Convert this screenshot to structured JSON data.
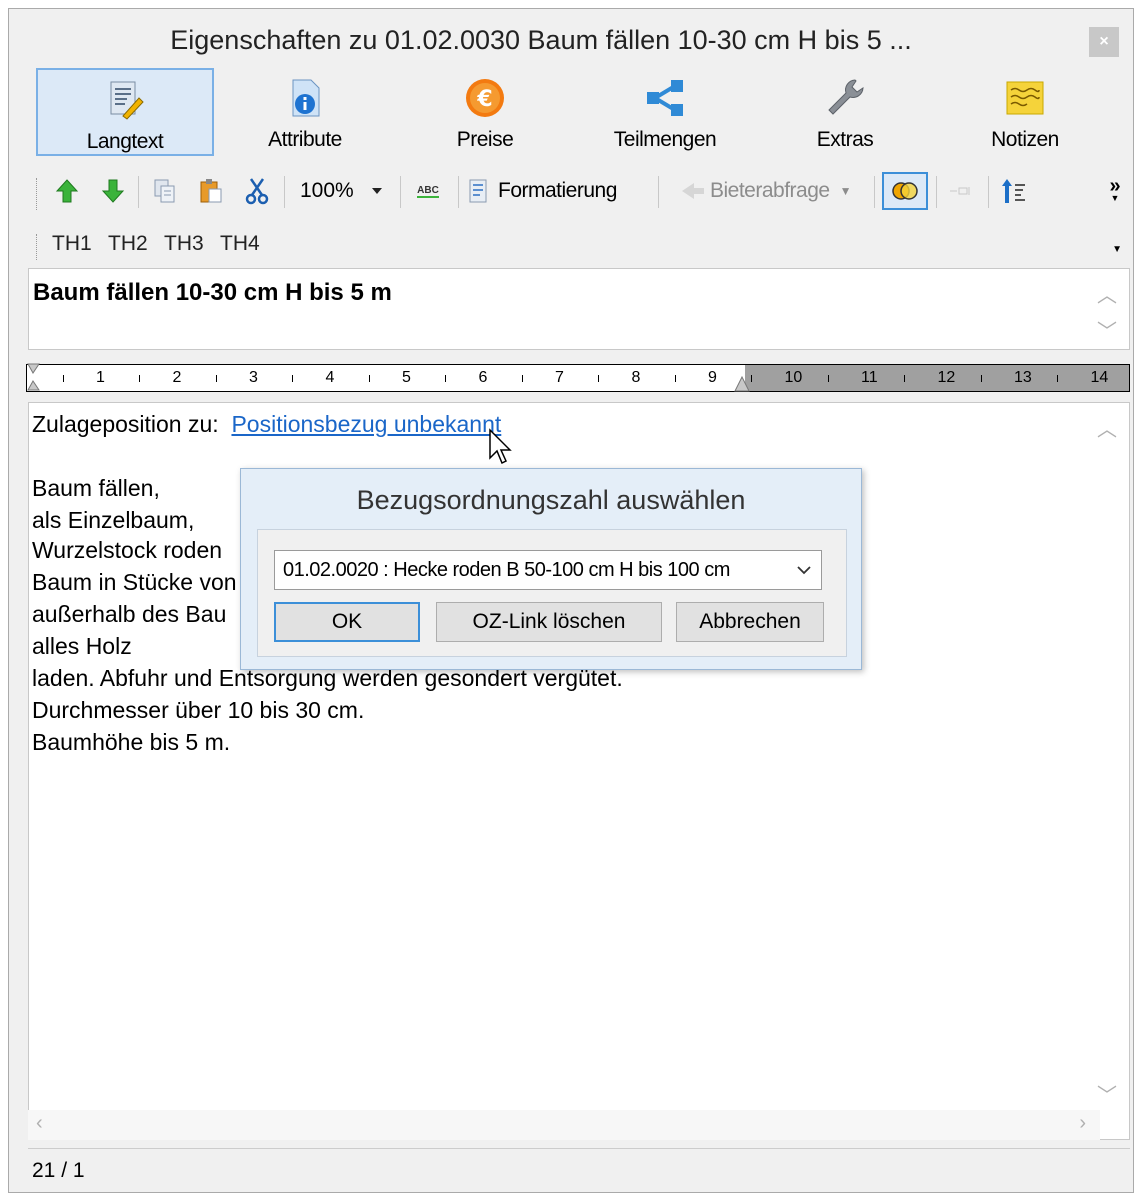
{
  "window": {
    "title": "Eigenschaften zu 01.02.0030 Baum fällen 10-30 cm H bis 5 ...",
    "close_label": "×"
  },
  "ribbon": {
    "tabs": [
      {
        "label": "Langtext",
        "icon": "langtext-icon",
        "active": true
      },
      {
        "label": "Attribute",
        "icon": "attribute-icon"
      },
      {
        "label": "Preise",
        "icon": "euro-icon"
      },
      {
        "label": "Teilmengen",
        "icon": "share-icon"
      },
      {
        "label": "Extras",
        "icon": "wrench-icon"
      },
      {
        "label": "Notizen",
        "icon": "notes-icon"
      }
    ]
  },
  "toolbar": {
    "zoom_value": "100%",
    "spell_label": "ABC",
    "format_label": "Formatierung",
    "bidder_label": "Bieterabfrage",
    "overflow_label": "»"
  },
  "tag_bar": {
    "items": [
      "TH1",
      "TH2",
      "TH3",
      "TH4"
    ]
  },
  "heading": {
    "text": "Baum fällen 10-30 cm H bis 5 m"
  },
  "ruler": {
    "numbers": [
      "1",
      "2",
      "3",
      "4",
      "5",
      "6",
      "7",
      "8",
      "9",
      "10",
      "11",
      "12",
      "13",
      "14"
    ]
  },
  "editor": {
    "prefix": "Zulageposition zu:",
    "link": "Positionsbezug unbekannt",
    "lines": [
      "Baum fällen,",
      "als Einzelbaum,",
      "Wurzelstock roden",
      "Baum in Stücke von",
      "außerhalb des Bau",
      "alles Holz",
      "laden. Abfuhr und Entsorgung werden gesondert vergütet.",
      "Durchmesser über 10 bis 30 cm.",
      "Baumhöhe bis 5 m."
    ]
  },
  "status": {
    "position": "21 / 1"
  },
  "dialog": {
    "title": "Bezugsordnungszahl auswählen",
    "select_value": "01.02.0020 : Hecke roden B 50-100 cm H bis 100 cm",
    "ok_label": "OK",
    "delete_label": "OZ-Link löschen",
    "cancel_label": "Abbrechen"
  },
  "colors": {
    "accent": "#3c8fd8",
    "link": "#1a66c8",
    "dialog_bg": "#e4eef8"
  }
}
